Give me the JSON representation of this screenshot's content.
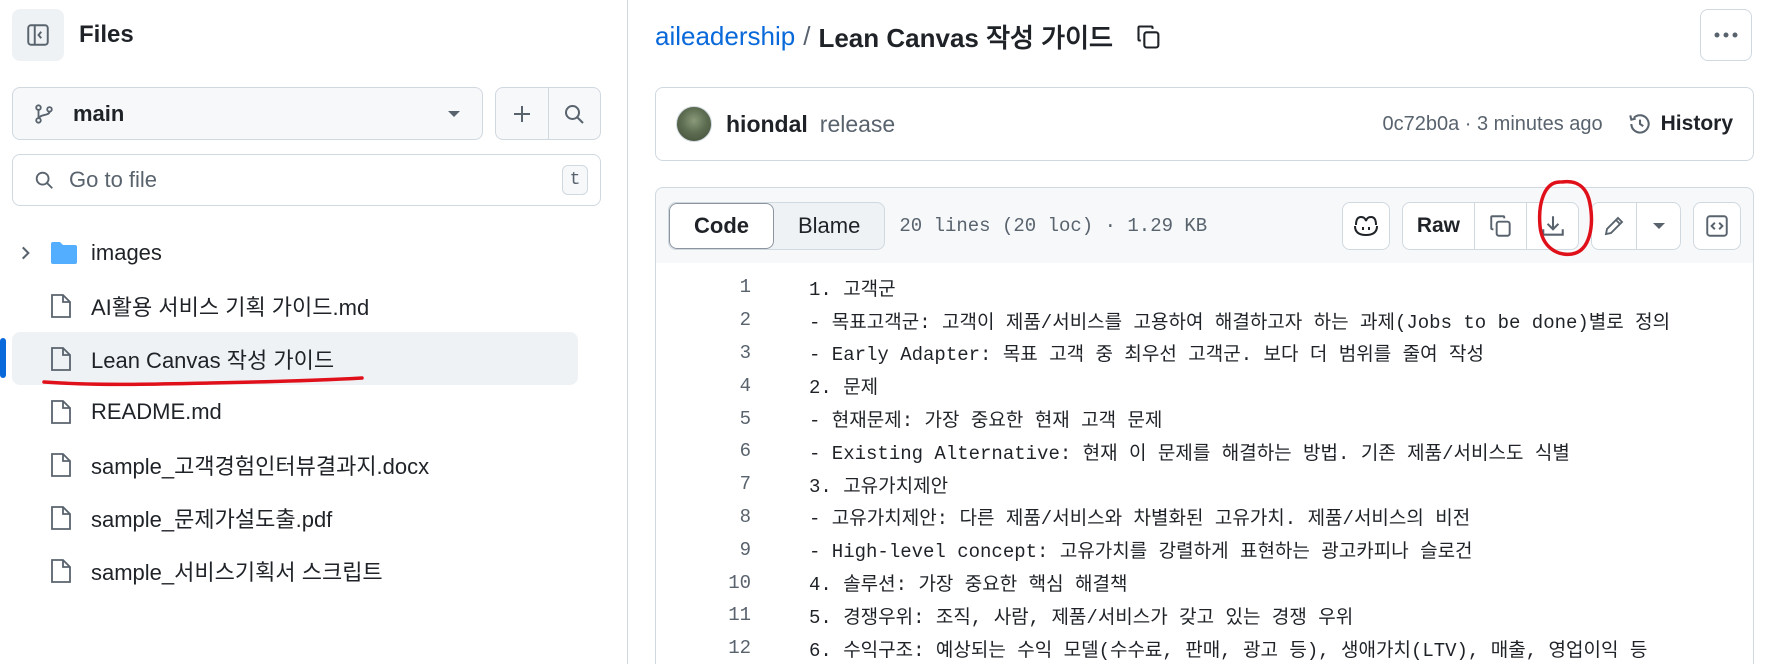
{
  "sidebar": {
    "title": "Files",
    "branch": "main",
    "search_placeholder": "Go to file",
    "search_shortcut": "t",
    "tree": [
      {
        "type": "folder",
        "name": "images"
      },
      {
        "type": "file",
        "name": "AI활용 서비스 기획 가이드.md"
      },
      {
        "type": "file",
        "name": "Lean Canvas 작성 가이드",
        "selected": true
      },
      {
        "type": "file",
        "name": "README.md"
      },
      {
        "type": "file",
        "name": "sample_고객경험인터뷰결과지.docx"
      },
      {
        "type": "file",
        "name": "sample_문제가설도출.pdf"
      },
      {
        "type": "file",
        "name": "sample_서비스기획서 스크립트"
      }
    ]
  },
  "breadcrumb": {
    "repo": "aileadership",
    "separator": "/",
    "file": "Lean Canvas 작성 가이드"
  },
  "commit": {
    "author": "hiondal",
    "message": "release",
    "meta": "0c72b0a · 3 minutes ago",
    "history_label": "History"
  },
  "file_header": {
    "tab_code": "Code",
    "tab_blame": "Blame",
    "info": "20 lines (20 loc) · 1.29 KB",
    "raw_label": "Raw"
  },
  "code_lines": [
    {
      "n": "1",
      "text": "1. 고객군"
    },
    {
      "n": "2",
      "text": "- 목표고객군: 고객이 제품/서비스를 고용하여 해결하고자 하는 과제(Jobs to be done)별로 정의"
    },
    {
      "n": "3",
      "text": "- Early Adapter: 목표 고객 중 최우선 고객군. 보다 더 범위를 줄여 작성"
    },
    {
      "n": "4",
      "text": "2. 문제"
    },
    {
      "n": "5",
      "text": "- 현재문제: 가장 중요한 현재 고객 문제"
    },
    {
      "n": "6",
      "text": "- Existing Alternative: 현재 이 문제를 해결하는 방법. 기존 제품/서비스도 식별"
    },
    {
      "n": "7",
      "text": "3. 고유가치제안"
    },
    {
      "n": "8",
      "text": "- 고유가치제안: 다른 제품/서비스와 차별화된 고유가치. 제품/서비스의 비전"
    },
    {
      "n": "9",
      "text": "- High-level concept: 고유가치를 강렬하게 표현하는 광고카피나 슬로건"
    },
    {
      "n": "10",
      "text": "4. 솔루션: 가장 중요한 핵심 해결책"
    },
    {
      "n": "11",
      "text": "5. 경쟁우위: 조직, 사람, 제품/서비스가 갖고 있는 경쟁 우위"
    },
    {
      "n": "12",
      "text": "6. 수익구조: 예상되는 수익 모델(수수료, 판매, 광고 등), 생애가치(LTV), 매출, 영업이익 등"
    }
  ],
  "colors": {
    "accent": "#0969da",
    "annotation": "#e0101a"
  }
}
